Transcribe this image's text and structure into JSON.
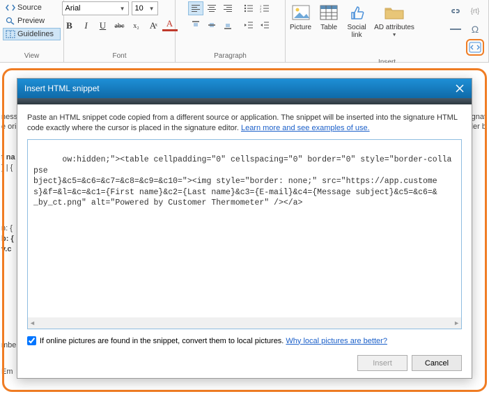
{
  "ribbon": {
    "view": {
      "label": "View",
      "source": "Source",
      "preview": "Preview",
      "guidelines": "Guidelines"
    },
    "font": {
      "label": "Font",
      "family": "Arial",
      "size": "10",
      "bold": "B",
      "italic": "I",
      "underline": "U",
      "strike": "abc",
      "sub": "x₂",
      "clear": "Aͯ",
      "color": "A"
    },
    "paragraph": {
      "label": "Paragraph"
    },
    "insert": {
      "label": "Insert",
      "picture": "Picture",
      "table": "Table",
      "social": "Social\nlink",
      "ad": "AD attributes"
    },
    "side": {
      "link": "link-icon",
      "rt": "{rt}",
      "omega": "Ω",
      "snippet": "html-snippet"
    }
  },
  "modal": {
    "title": "Insert HTML snippet",
    "desc_1": "Paste an HTML snippet code copied from a different source or application. The snippet will be inserted into the signature HTML code exactly where the cursor is placed in the signature editor. ",
    "desc_link": "Learn more and see examples of use.",
    "snippet": "ow:hidden;\"><table cellpadding=\"0\" cellspacing=\"0\" border=\"0\" style=\"border-collapse\nbject}&c5=&c6=&c7=&c8=&c9=&c10=\"><img style=\"border: none;\" src=\"https://app.custome\ns}&f=&l=&c=&c1={First name}&c2={Last name}&c3={E-mail}&c4={Message subject}&c5=&c6=&\n_by_ct.png\" alt=\"Powered by Customer Thermometer\" /></a>",
    "checkbox_label": "If online pictures are found in the snippet, convert them to local pictures. ",
    "checkbox_link": "Why local pictures are better?",
    "checkbox_checked": true,
    "insert_btn": "Insert",
    "cancel_btn": "Cancel"
  },
  "background": {
    "line1": "ness",
    "line2": "e ori",
    "line3": "t na",
    "line4": "} | {",
    "line5": "n: {",
    "line6": "b: {",
    "line7": "v.c",
    "line8": "mbe",
    "line9": "Em",
    "right1": "signat",
    "right2": "older b"
  }
}
